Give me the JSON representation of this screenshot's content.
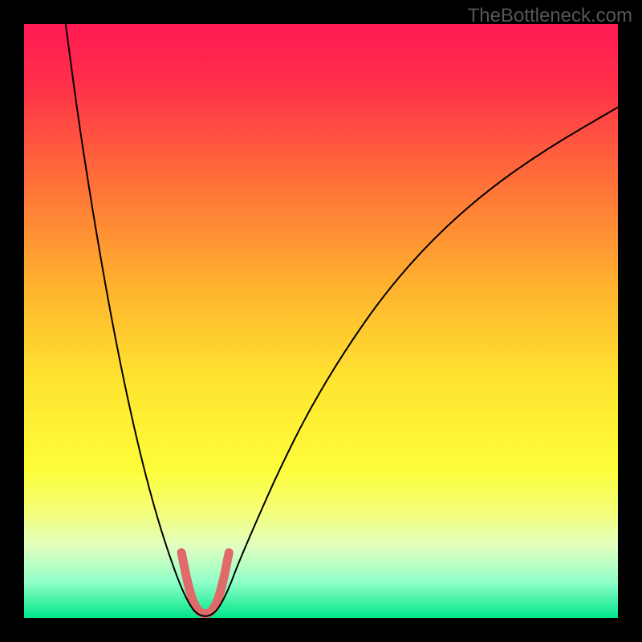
{
  "watermark": "TheBottleneck.com",
  "chart_data": {
    "type": "line",
    "title": "",
    "xlabel": "",
    "ylabel": "",
    "xlim": [
      0,
      100
    ],
    "ylim": [
      0,
      100
    ],
    "background_gradient_stops": [
      {
        "offset": 0.0,
        "color": "#ff1a53"
      },
      {
        "offset": 0.1,
        "color": "#ff2f4a"
      },
      {
        "offset": 0.25,
        "color": "#ff6a3a"
      },
      {
        "offset": 0.45,
        "color": "#ffb52e"
      },
      {
        "offset": 0.6,
        "color": "#ffe430"
      },
      {
        "offset": 0.75,
        "color": "#fdfd3a"
      },
      {
        "offset": 0.82,
        "color": "#f5ff77"
      },
      {
        "offset": 0.88,
        "color": "#e0ffc0"
      },
      {
        "offset": 0.94,
        "color": "#90ffc8"
      },
      {
        "offset": 1.0,
        "color": "#00e68a"
      }
    ],
    "series": [
      {
        "name": "curve",
        "color": "#000000",
        "width": 2,
        "points": [
          {
            "x": 7,
            "y": 100
          },
          {
            "x": 9,
            "y": 85
          },
          {
            "x": 11,
            "y": 72
          },
          {
            "x": 13,
            "y": 60
          },
          {
            "x": 15,
            "y": 49
          },
          {
            "x": 17,
            "y": 39
          },
          {
            "x": 19,
            "y": 30
          },
          {
            "x": 21,
            "y": 22
          },
          {
            "x": 23,
            "y": 15
          },
          {
            "x": 25,
            "y": 9
          },
          {
            "x": 26.5,
            "y": 5
          },
          {
            "x": 28,
            "y": 2
          },
          {
            "x": 29,
            "y": 0.8
          },
          {
            "x": 30,
            "y": 0.3
          },
          {
            "x": 31,
            "y": 0.3
          },
          {
            "x": 32,
            "y": 0.8
          },
          {
            "x": 33,
            "y": 2
          },
          {
            "x": 34.5,
            "y": 5
          },
          {
            "x": 36,
            "y": 9
          },
          {
            "x": 39,
            "y": 16
          },
          {
            "x": 43,
            "y": 25
          },
          {
            "x": 48,
            "y": 35
          },
          {
            "x": 54,
            "y": 45
          },
          {
            "x": 61,
            "y": 55
          },
          {
            "x": 69,
            "y": 64
          },
          {
            "x": 78,
            "y": 72
          },
          {
            "x": 88,
            "y": 79
          },
          {
            "x": 100,
            "y": 86
          }
        ]
      },
      {
        "name": "highlight",
        "color": "#e06a6a",
        "width": 11,
        "points": [
          {
            "x": 26.5,
            "y": 11
          },
          {
            "x": 27.5,
            "y": 6
          },
          {
            "x": 28.5,
            "y": 2.5
          },
          {
            "x": 29.5,
            "y": 1
          },
          {
            "x": 30.5,
            "y": 0.6
          },
          {
            "x": 31.5,
            "y": 1
          },
          {
            "x": 32.5,
            "y": 2.5
          },
          {
            "x": 33.5,
            "y": 6
          },
          {
            "x": 34.5,
            "y": 11
          }
        ]
      }
    ]
  }
}
